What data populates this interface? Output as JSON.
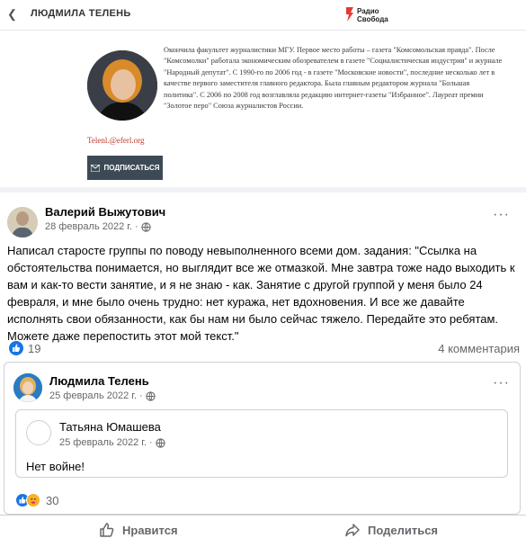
{
  "header": {
    "author_name": "ЛЮДМИЛА ТЕЛЕНЬ",
    "logo_line1": "Радио",
    "logo_line2": "Свобода",
    "back_icon": "chevron-left-icon"
  },
  "bio": {
    "text": "Окончила факультет журналистики МГУ. Первое место работы – газета \"Комсомольская правда\". После \"Комсомолки\" работала экономическим обозревателем в газете \"Социалистическая индустрия\" и журнале \"Народный депутат\". С 1990-го по 2006 год - в газете \"Московские новости\", последние несколько лет в качестве первого заместителя главного редактора. Была главным редактором журнала \"Большая политика\". С 2006 по 2008 год возглавляла редакцию интернет-газеты \"Избранное\". Лауреат премии \"Золотое перо\" Союза журналистов России.",
    "email": "Telenl.@eferl.org",
    "subscribe_label": "ПОДПИСАТЬСЯ"
  },
  "post": {
    "author": "Валерий Выжутович",
    "date": "28 февраль 2022 г. ·",
    "text": "Написал старосте группы по поводу невыполненного всеми дом. задания: \"Ссылка на обстоятельства понимается, но выглядит все же отмазкой. Мне завтра тоже надо выходить к вам и как-то вести занятие, и я не знаю  - как. Занятие с другой группой у меня было 24 февраля, и мне было очень трудно: нет куража, нет вдохновения. И все же давайте исполнять свои обязанности, как бы нам ни было сейчас тяжело. Передайте это ребятам. Можете даже перепостить этот мой текст.\"",
    "likes": "19",
    "comments": "4 комментария"
  },
  "shared": {
    "author": "Людмила Телень",
    "date": "25 февраль 2022 г. ·",
    "inner_author": "Татьяна Юмашева",
    "inner_date": "25 февраль 2022 г. ·",
    "inner_text": "Нет войне!",
    "reactions_count": "30"
  },
  "actions": {
    "like_label": "Нравится",
    "share_label": "Поделиться"
  },
  "colors": {
    "accent": "#1b74e4",
    "subscribe_bg": "#3d4a56",
    "email": "#c0392b",
    "muted": "#65676b"
  }
}
